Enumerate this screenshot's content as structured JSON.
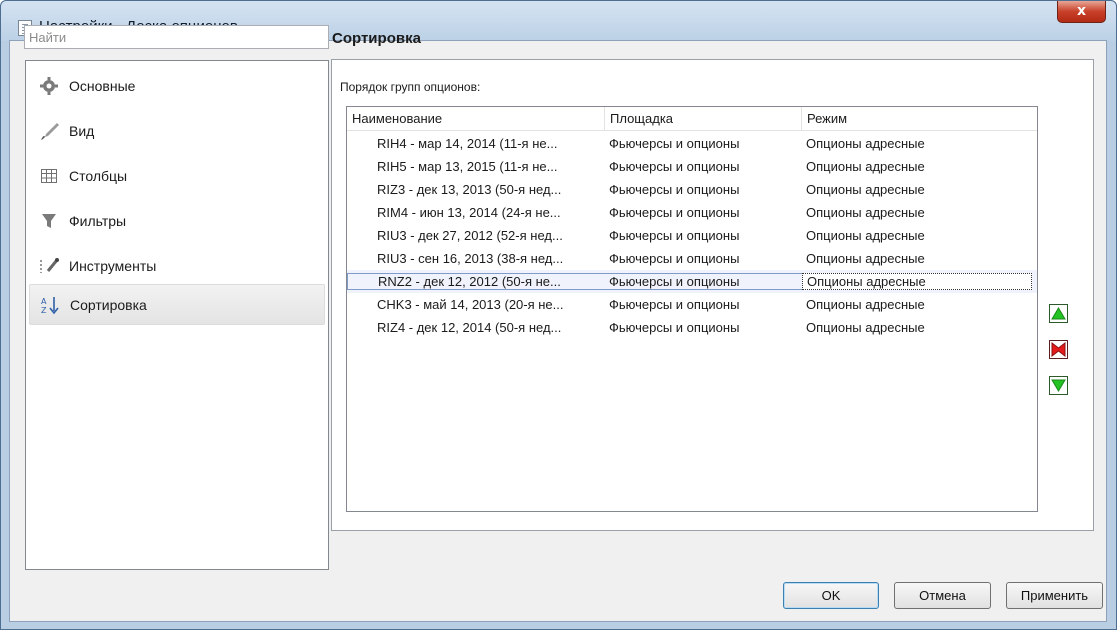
{
  "window": {
    "title": "Настройки - Доска опционов",
    "close_label": "x"
  },
  "search": {
    "placeholder": "Найти"
  },
  "sidebar": {
    "items": [
      {
        "label": "Основные",
        "icon": "gear-icon"
      },
      {
        "label": "Вид",
        "icon": "brush-icon"
      },
      {
        "label": "Столбцы",
        "icon": "table-icon"
      },
      {
        "label": "Фильтры",
        "icon": "filter-icon"
      },
      {
        "label": "Инструменты",
        "icon": "tools-icon"
      },
      {
        "label": "Сортировка",
        "icon": "sort-az-icon",
        "active": true
      }
    ]
  },
  "main": {
    "section_title": "Сортировка",
    "group_label": "Порядок групп опционов:",
    "columns": [
      "Наименование",
      "Площадка",
      "Режим"
    ],
    "rows": [
      {
        "name": "RIH4 - мар 14, 2014 (11-я не...",
        "place": "Фьючерсы и опционы",
        "mode": "Опционы адресные"
      },
      {
        "name": "RIH5 - мар 13, 2015 (11-я не...",
        "place": "Фьючерсы и опционы",
        "mode": "Опционы адресные"
      },
      {
        "name": "RIZ3 - дек 13, 2013 (50-я нед...",
        "place": "Фьючерсы и опционы",
        "mode": "Опционы адресные"
      },
      {
        "name": "RIM4 - июн 13, 2014 (24-я не...",
        "place": "Фьючерсы и опционы",
        "mode": "Опционы адресные"
      },
      {
        "name": "RIU3 - дек 27, 2012 (52-я нед...",
        "place": "Фьючерсы и опционы",
        "mode": "Опционы адресные"
      },
      {
        "name": "RIU3 - сен 16, 2013 (38-я нед...",
        "place": "Фьючерсы и опционы",
        "mode": "Опционы адресные"
      },
      {
        "name": "RNZ2 - дек 12, 2012 (50-я не...",
        "place": "Фьючерсы и опционы",
        "mode": "Опционы адресные",
        "selected": true
      },
      {
        "name": "CHK3 - май 14, 2013 (20-я не...",
        "place": "Фьючерсы и опционы",
        "mode": "Опционы адресные"
      },
      {
        "name": "RIZ4 - дек 12, 2014 (50-я нед...",
        "place": "Фьючерсы и опционы",
        "mode": "Опционы адресные"
      }
    ],
    "side_buttons": [
      "move-up-icon",
      "delete-icon",
      "move-down-icon"
    ]
  },
  "buttons": {
    "ok": "OK",
    "cancel": "Отмена",
    "apply": "Применить"
  },
  "colors": {
    "accent_green": "#22c322",
    "delete_red": "#e41b1b",
    "selection": "#7f9cc8"
  }
}
